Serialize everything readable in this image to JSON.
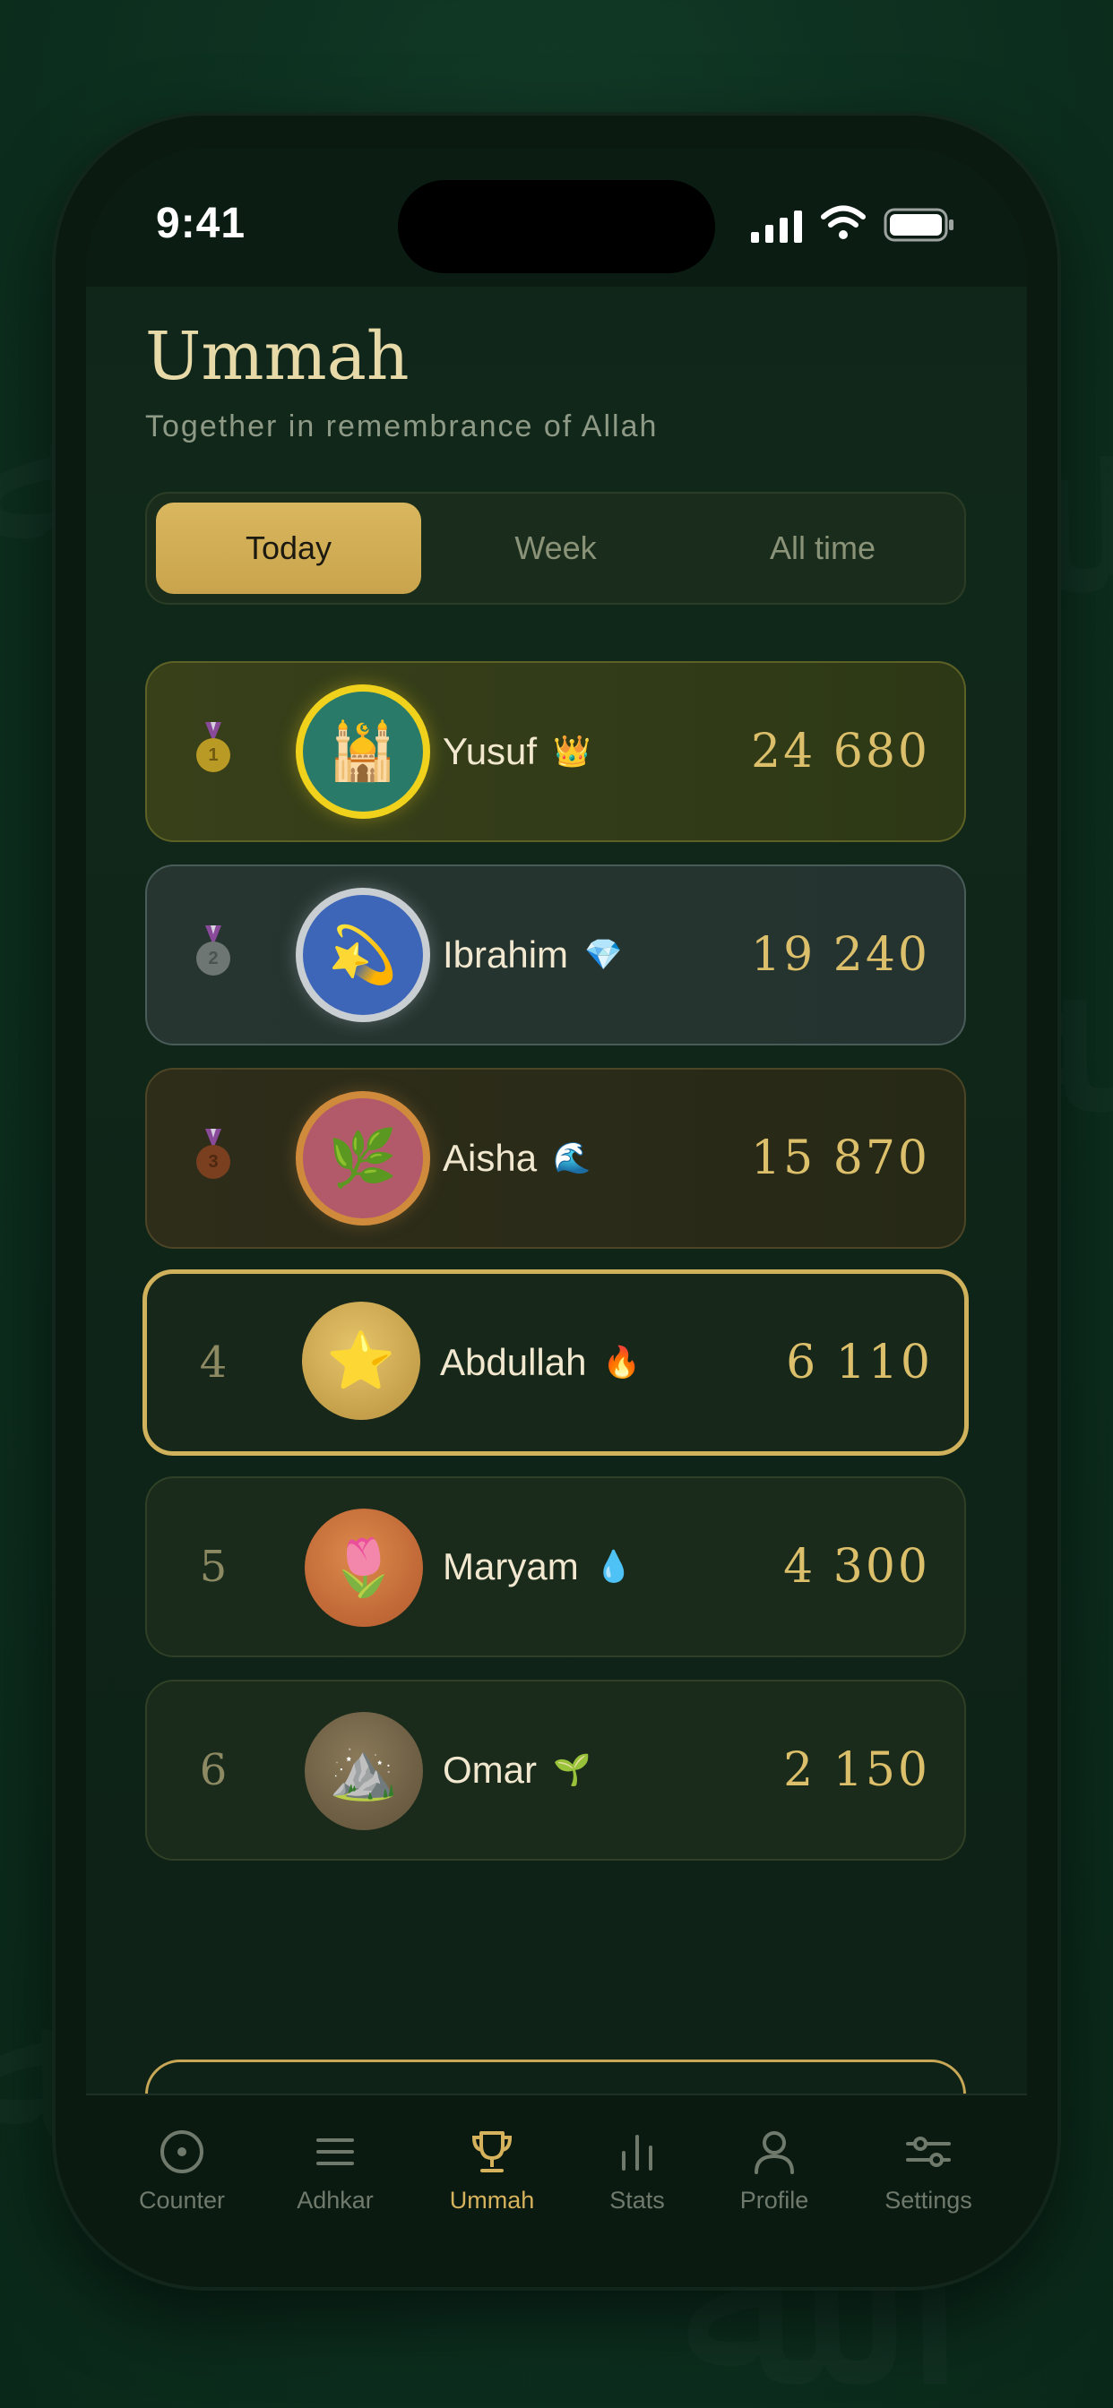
{
  "status_bar": {
    "time": "9:41",
    "icons": [
      "cellular-signal-icon",
      "wifi-icon",
      "battery-icon"
    ]
  },
  "header": {
    "title": "Ummah",
    "subtitle": "Together in remembrance of Allah"
  },
  "period_tabs": {
    "options": [
      "Today",
      "Week",
      "All time"
    ],
    "selected": "Today"
  },
  "leaderboard": [
    {
      "rank": "1",
      "name": "Yusuf",
      "badge": "👑",
      "avatar": "🕌",
      "score": "24 680",
      "medal": "gold"
    },
    {
      "rank": "2",
      "name": "Ibrahim",
      "badge": "💎",
      "avatar": "💫",
      "score": "19 240",
      "medal": "silver"
    },
    {
      "rank": "3",
      "name": "Aisha",
      "badge": "🌊",
      "avatar": "🌿",
      "score": "15 870",
      "medal": "bronze"
    },
    {
      "rank": "4",
      "name": "Abdullah",
      "badge": "🔥",
      "avatar": "⭐",
      "score": "6 110",
      "current_user": true
    },
    {
      "rank": "5",
      "name": "Maryam",
      "badge": "💧",
      "avatar": "🌷",
      "score": "4 300"
    },
    {
      "rank": "6",
      "name": "Omar",
      "badge": "🌱",
      "avatar": "⛰️",
      "score": "2 150"
    }
  ],
  "tab_bar": {
    "items": [
      {
        "label": "Counter",
        "icon": "counter-icon"
      },
      {
        "label": "Adhkar",
        "icon": "list-icon"
      },
      {
        "label": "Ummah",
        "icon": "trophy-icon"
      },
      {
        "label": "Stats",
        "icon": "bar-chart-icon"
      },
      {
        "label": "Profile",
        "icon": "person-icon"
      },
      {
        "label": "Settings",
        "icon": "sliders-icon"
      }
    ],
    "active": "Ummah"
  },
  "colors": {
    "accent_gold": "#d6b25c",
    "background": "#0e3221",
    "text_cream": "#f1e8cf"
  }
}
